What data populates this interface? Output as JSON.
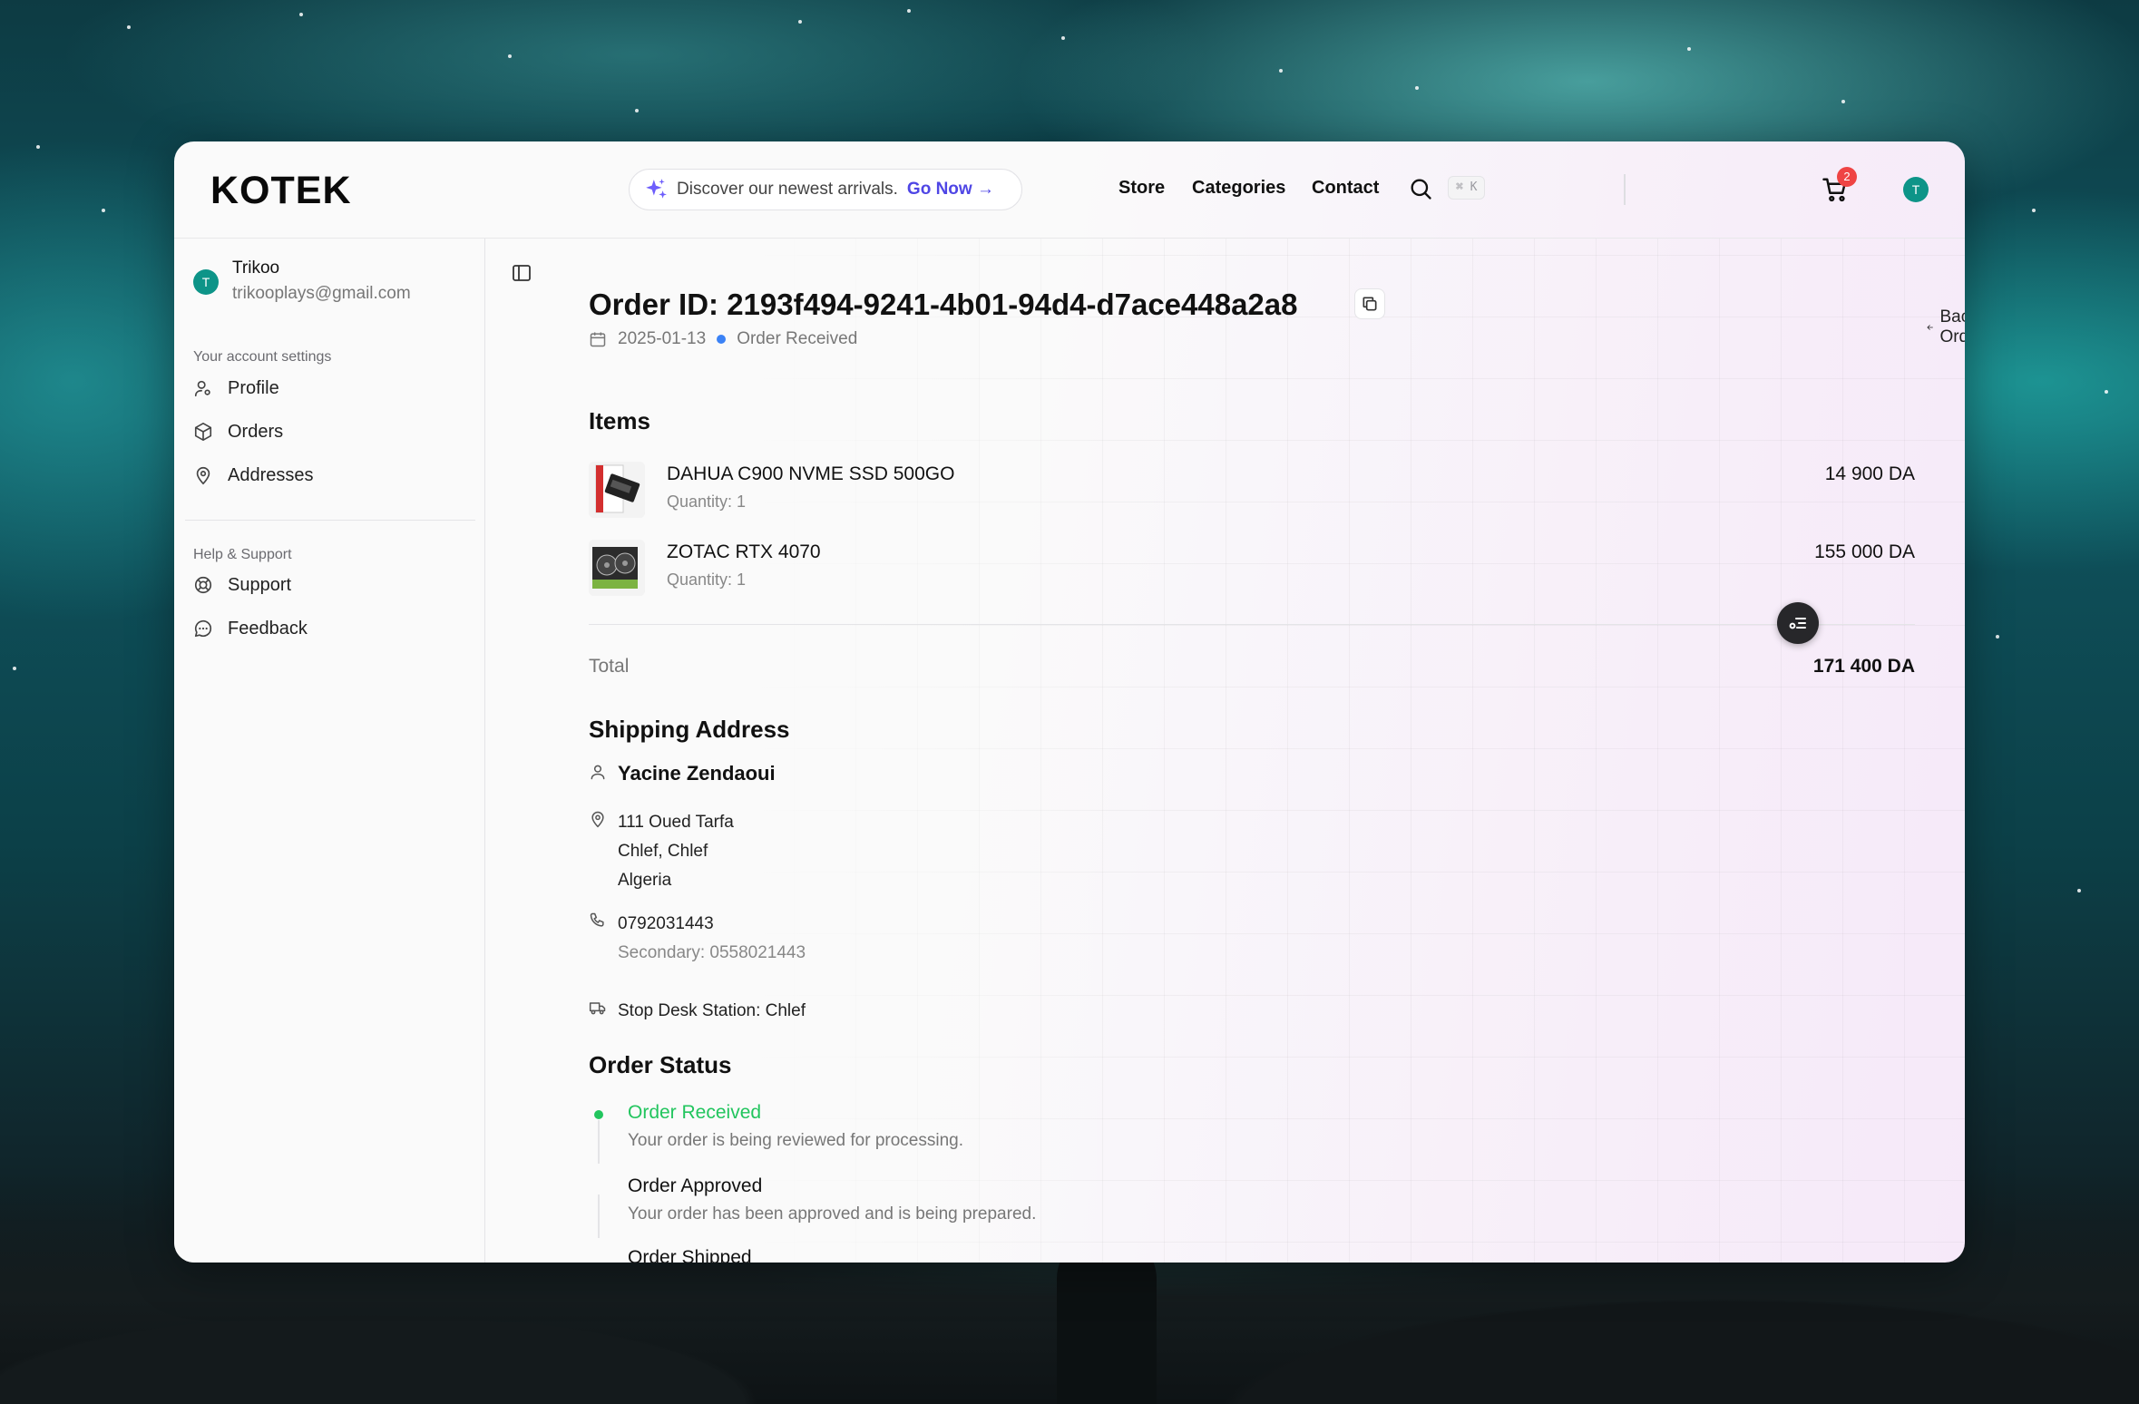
{
  "header": {
    "logo": "KOTEK",
    "promo_text": "Discover our newest arrivals.",
    "promo_link": "Go Now →",
    "nav": [
      "Store",
      "Categories",
      "Contact"
    ],
    "search_shortcut": "⌘ K",
    "cart_count": "2",
    "avatar_initial": "T"
  },
  "sidebar": {
    "user": {
      "initial": "T",
      "name": "Trikoo",
      "email": "trikooplays@gmail.com"
    },
    "account_section": "Your account settings",
    "account_items": [
      "Profile",
      "Orders",
      "Addresses"
    ],
    "help_section": "Help & Support",
    "help_items": [
      "Support",
      "Feedback"
    ]
  },
  "order": {
    "title": "Order ID: 2193f494-9241-4b01-94d4-d7ace448a2a8",
    "date": "2025-01-13",
    "status": "Order Received",
    "back_label": "Back to Orders",
    "items_heading": "Items",
    "items": [
      {
        "name": "DAHUA C900 NVME SSD 500GO",
        "qty": "Quantity: 1",
        "price": "14 900 DA"
      },
      {
        "name": "ZOTAC RTX 4070",
        "qty": "Quantity: 1",
        "price": "155 000 DA"
      }
    ],
    "total_label": "Total",
    "total_value": "171 400 DA"
  },
  "shipping": {
    "heading": "Shipping Address",
    "name": "Yacine Zendaoui",
    "address_line1": "111 Oued Tarfa",
    "address_line2": "Chlef, Chlef",
    "address_line3": "Algeria",
    "phone": "0792031443",
    "secondary_phone": "Secondary: 0558021443",
    "delivery": "Stop Desk Station: Chlef"
  },
  "status_section": {
    "heading": "Order Status",
    "steps": [
      {
        "title": "Order Received",
        "desc": "Your order is being reviewed for processing."
      },
      {
        "title": "Order Approved",
        "desc": "Your order has been approved and is being prepared."
      },
      {
        "title": "Order Shipped",
        "desc": ""
      }
    ]
  },
  "colors": {
    "accent": "#4f46e5",
    "success": "#22c55e",
    "status_dot": "#3b82f6",
    "avatar": "#0d9488",
    "badge": "#ef4444"
  }
}
